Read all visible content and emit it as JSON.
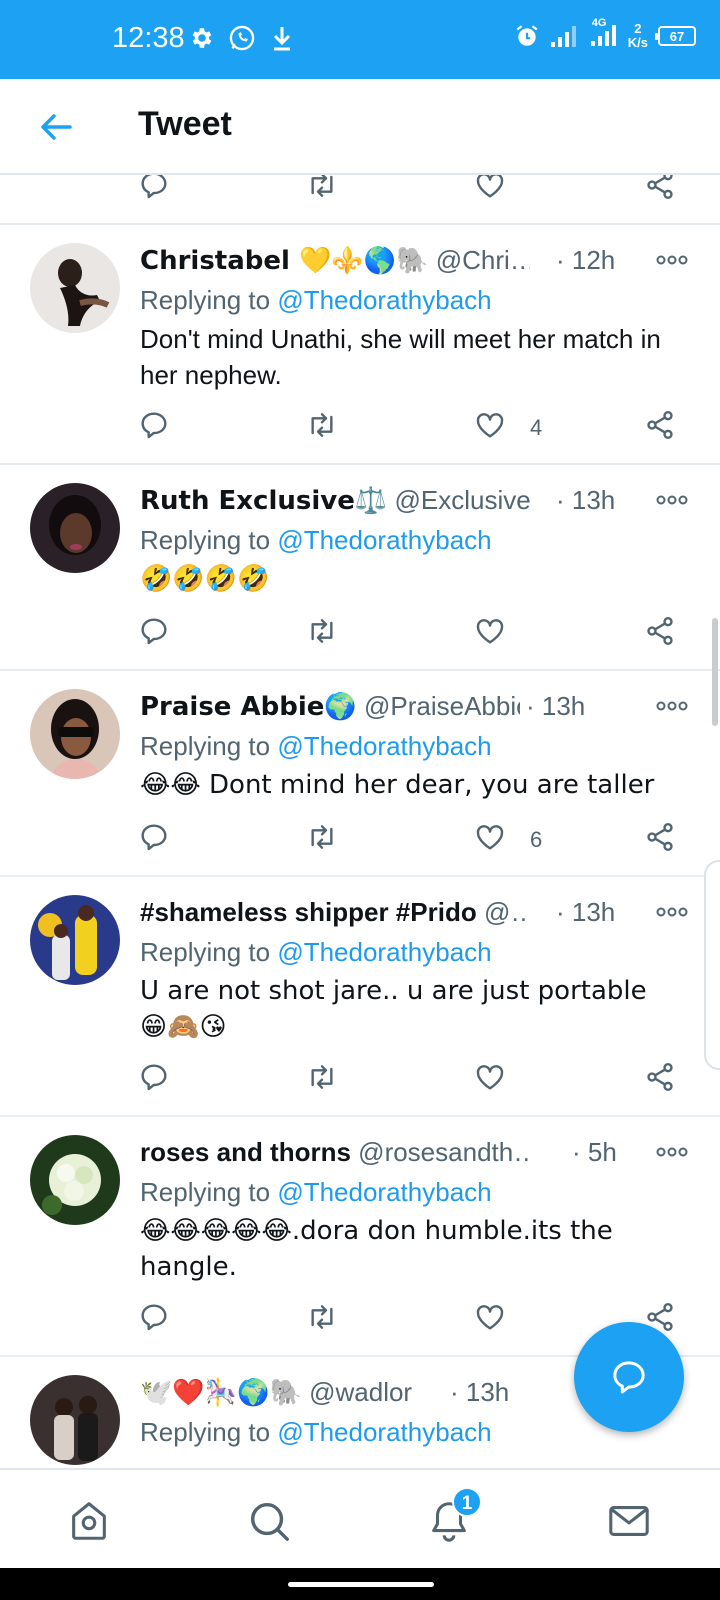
{
  "status_bar": {
    "time": "12:38",
    "network": "4G",
    "speed_value": "2",
    "speed_unit": "K/s",
    "battery": "67"
  },
  "header": {
    "title": "Tweet"
  },
  "reply_prefix": "Replying to",
  "counts": {
    "tweet1_likes": "4",
    "tweet3_likes": "6"
  },
  "tweets": [
    {
      "name": "Christabel 💛⚜️🌎🐘",
      "handle": "@Chri…",
      "time": "· 12h",
      "mention": "@Thedorathybach",
      "text": "Don't mind Unathi, she will meet her match in her nephew."
    },
    {
      "name": "Ruth Exclusive⚖️",
      "handle": "@Exclusive…",
      "time": "· 13h",
      "mention": "@Thedorathybach",
      "text": "🤣🤣🤣🤣"
    },
    {
      "name": "Praise Abbie🌍",
      "handle": "@PraiseAbbie",
      "time": "· 13h",
      "mention": "@Thedorathybach",
      "text": "😂😂 Dont mind her dear, you are taller"
    },
    {
      "name": "#shameless shipper #Prido",
      "handle": "@…",
      "time": "· 13h",
      "mention": "@Thedorathybach",
      "text": "U are not shot jare.. u are just portable 😁🙈😘"
    },
    {
      "name": "roses and thorns",
      "handle": "@rosesandth…",
      "time": "· 5h",
      "mention": "@Thedorathybach",
      "text": "😂😂😂😂😂.dora don humble.its the hangle."
    },
    {
      "name": "🕊️❤️🎠🌍🐘",
      "handle": "@wadlor",
      "time": "· 13h",
      "mention": "@Thedorathybach",
      "text": ""
    }
  ],
  "bottom_nav": {
    "notification_badge": "1"
  },
  "colors": {
    "accent": "#1da1f2",
    "link": "#1d9bf0",
    "muted": "#536471"
  }
}
